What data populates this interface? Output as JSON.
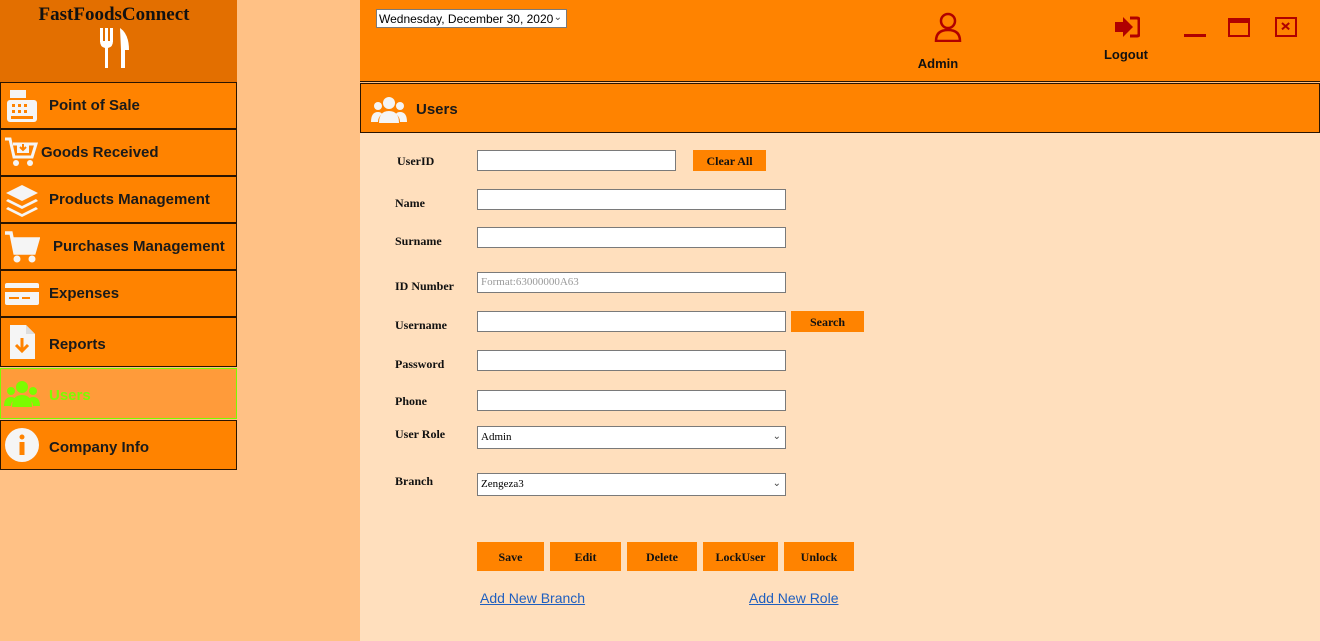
{
  "brand": {
    "name": "FastFoodsConnect",
    "logo_icon": "fork-knife-icon"
  },
  "sidebar": {
    "items": [
      {
        "label": "Point of Sale",
        "icon": "cash-register-icon"
      },
      {
        "label": "Goods Received",
        "icon": "cart-download-icon"
      },
      {
        "label": "Products Management",
        "icon": "layers-icon"
      },
      {
        "label": "Purchases Management",
        "icon": "shopping-cart-icon"
      },
      {
        "label": "Expenses",
        "icon": "credit-card-icon"
      },
      {
        "label": "Reports",
        "icon": "file-download-icon"
      },
      {
        "label": "Users",
        "icon": "users-icon",
        "active": true
      },
      {
        "label": "Company Info",
        "icon": "info-icon"
      }
    ]
  },
  "header": {
    "date": "Wednesday, December 30, 2020",
    "user_label": "Admin",
    "logout_label": "Logout"
  },
  "section": {
    "title": "Users"
  },
  "form": {
    "userid": {
      "label": "UserID",
      "value": ""
    },
    "clear_all": "Clear All",
    "name": {
      "label": "Name",
      "value": ""
    },
    "surname": {
      "label": "Surname",
      "value": ""
    },
    "id_number": {
      "label": "ID Number",
      "placeholder": "Format:63000000A63"
    },
    "username": {
      "label": "Username",
      "value": ""
    },
    "search": "Search",
    "password": {
      "label": "Password",
      "value": ""
    },
    "phone": {
      "label": "Phone",
      "value": ""
    },
    "user_role": {
      "label": "User Role",
      "selected": "Admin"
    },
    "branch": {
      "label": "Branch",
      "selected": "Zengeza3"
    }
  },
  "actions": {
    "save": "Save",
    "edit": "Edit",
    "delete": "Delete",
    "lock_user": "LockUser",
    "unlock": "Unlock"
  },
  "links": {
    "add_branch": "Add New Branch",
    "add_role": "Add New Role"
  },
  "colors": {
    "accent": "#ff8300",
    "sidebar_bg": "#ffc185",
    "content_bg": "#ffdfbd",
    "active_text": "#7cfc00",
    "window_controls": "#b00000"
  }
}
